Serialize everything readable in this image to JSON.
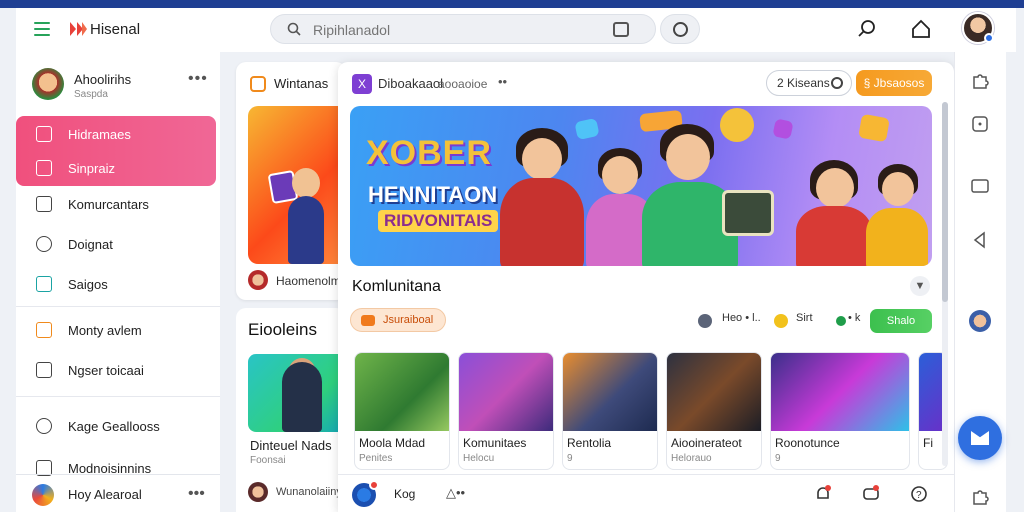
{
  "app": {
    "title": "Hisenal"
  },
  "search": {
    "placeholder": "Ripihlanadol"
  },
  "icons": {
    "menu": "hamburger-icon",
    "logo": "app-logo-icon",
    "search": "search-icon",
    "calendar": "calendar-icon",
    "clock": "clock-icon",
    "lens": "magnifier-icon",
    "home": "home-icon",
    "add": "add-icon",
    "mail": "mail-icon"
  },
  "colors": {
    "accent": "#2f6fe0",
    "active_nav": "#f0507d",
    "cta": "#f59a1f",
    "success": "#3cc04e",
    "top_strip": "#1f3f93"
  },
  "sidebar": {
    "profile": {
      "name": "Ahoolirihs",
      "subtitle": "Saspda"
    },
    "more": "•••",
    "items": [
      {
        "label": "Hidramaes",
        "active": true
      },
      {
        "label": "Sinpraiz",
        "active": true
      },
      {
        "label": "Komurcantars",
        "active": false
      },
      {
        "label": "Doignat",
        "active": false
      },
      {
        "label": "Saigos",
        "active": false
      },
      {
        "label": "Monty avlem",
        "active": false
      },
      {
        "label": "Ngser toicaai",
        "active": false
      },
      {
        "label": "Kage Geallooss",
        "active": false
      },
      {
        "label": "Modnoisinnins",
        "active": false
      }
    ],
    "bottom": {
      "label": "Hoy Alearoal",
      "more": "•••"
    }
  },
  "left_card": {
    "title": "Wintanas",
    "footer": "Haomenolmig"
  },
  "left_card2": {
    "title": "Eiooleins",
    "video_title": "Dinteuel Nads",
    "video_sub": "Foonsai",
    "footer": "Wunanolaiiny"
  },
  "panel": {
    "header_title": "Diboakaaol",
    "header_sub": "aooaoioe",
    "header_more": "••",
    "search_pill": "2 Kiseans",
    "cta": "§ Jbsaosos",
    "hero": {
      "line1": "XOBER",
      "line2": "HENNITAON",
      "line3": "RIDVONITAIS"
    },
    "section_title": "Komlunitana",
    "chip_orange": "Jsuraiboal",
    "filters": [
      "Heo • l..",
      "Sirt",
      "• k"
    ],
    "green_btn": "Shalo",
    "thumbs": [
      {
        "title": "Moola Mdad",
        "sub": "Penites"
      },
      {
        "title": "Komunitaes",
        "sub": "Helocu"
      },
      {
        "title": "Rentolia",
        "sub": "9"
      },
      {
        "title": "Aiooinerateot",
        "sub": "Helorauo"
      },
      {
        "title": "Roonotunce",
        "sub": "9"
      },
      {
        "title": "Fi",
        "sub": ""
      }
    ],
    "footer": {
      "label": "Kog",
      "extra": "△••"
    }
  }
}
